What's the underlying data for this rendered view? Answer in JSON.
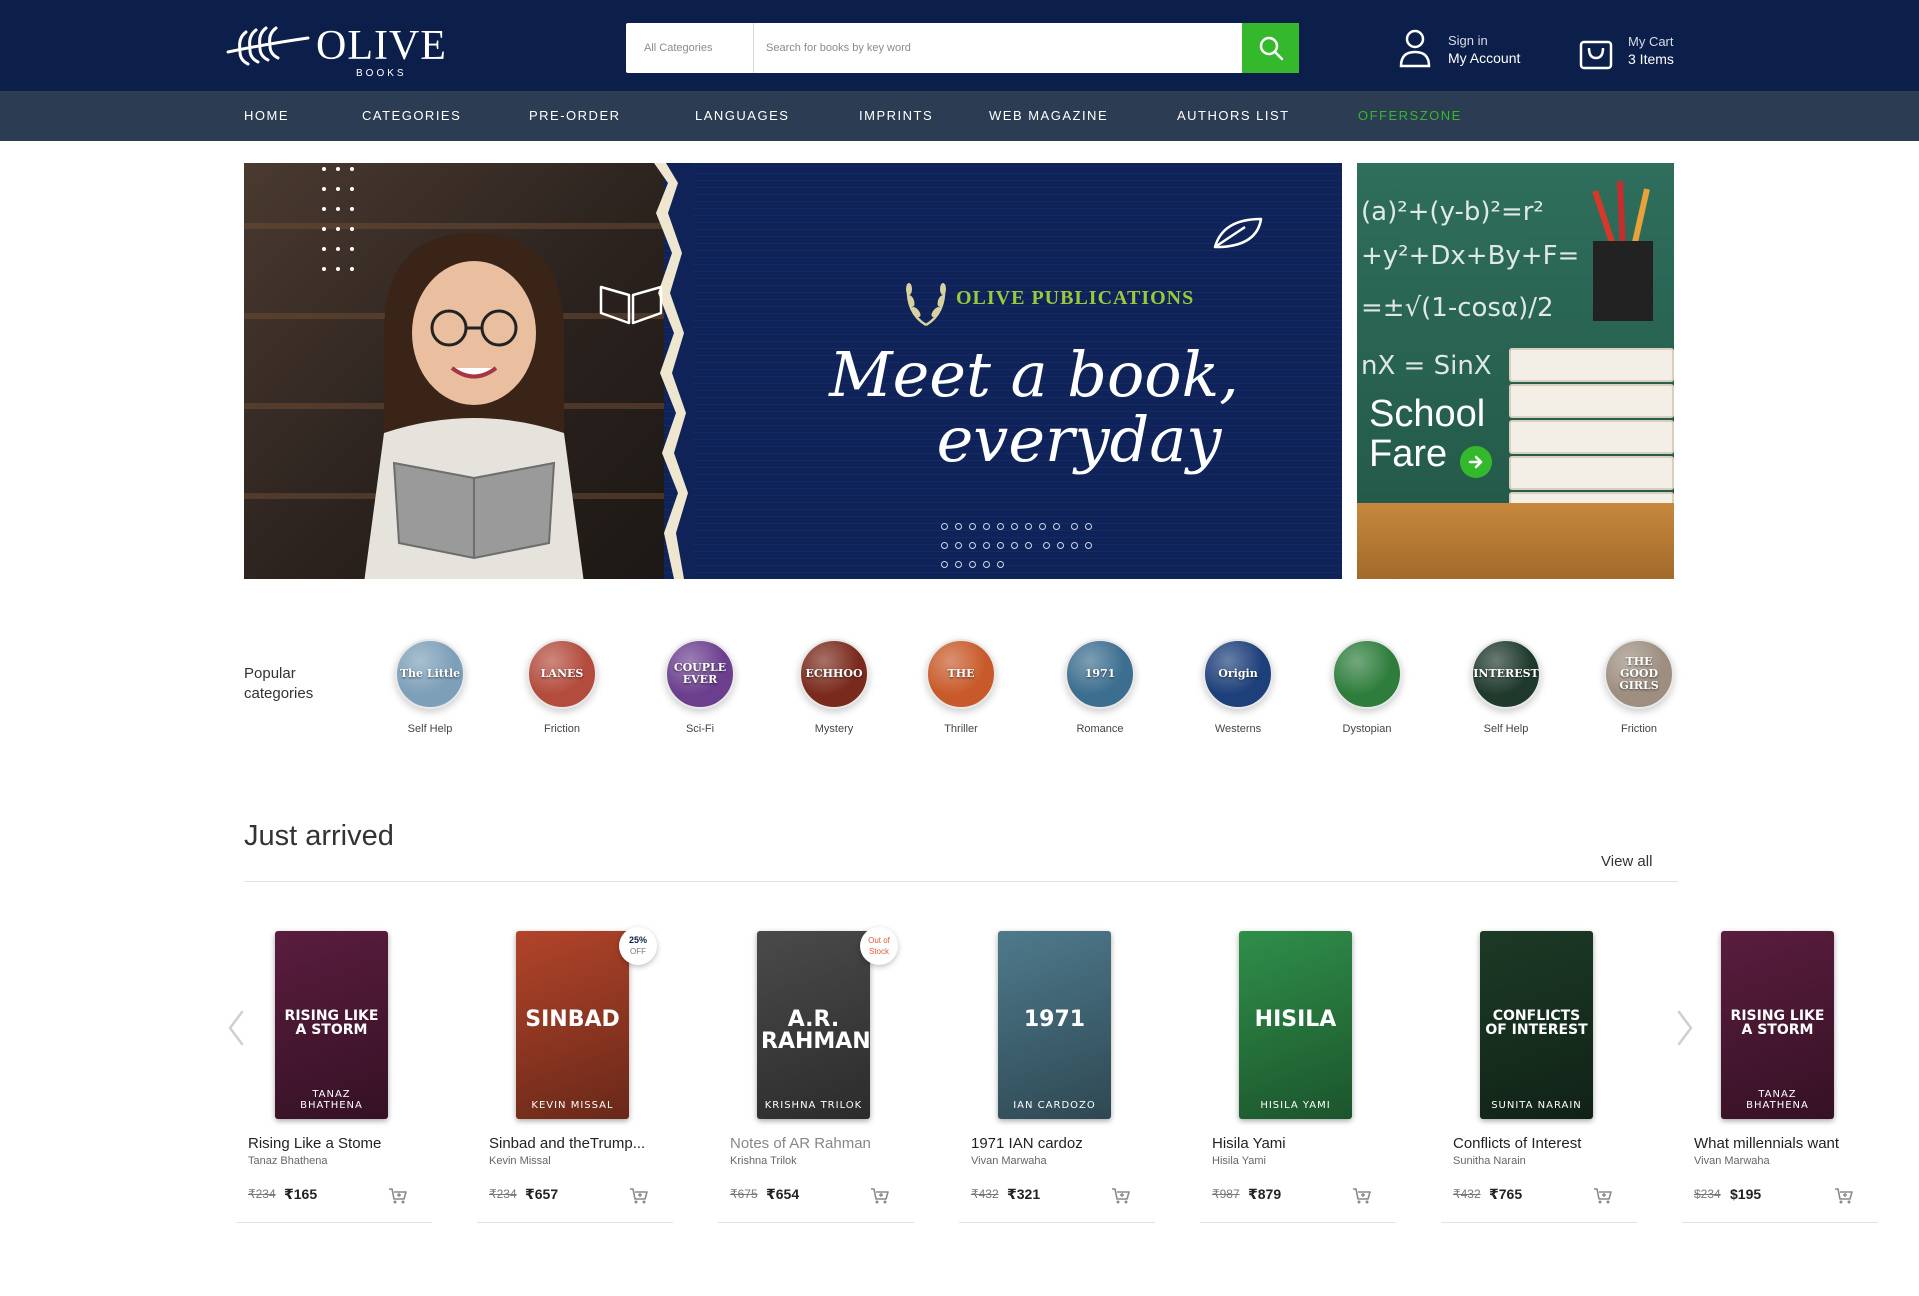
{
  "header": {
    "logo_text": "OLIVE",
    "logo_sub": "BOOKS",
    "search": {
      "category": "All Categories",
      "placeholder": "Search for books by key word"
    },
    "account": {
      "line1": "Sign in",
      "line2": "My Account"
    },
    "cart": {
      "line1": "My Cart",
      "line2": "3 Items"
    },
    "accent": "#35b92c",
    "bg": "#0c1f4a"
  },
  "nav": {
    "items": [
      "HOME",
      "CATEGORIES",
      "PRE-ORDER",
      "LANGUAGES",
      "IMPRINTS",
      "WEB MAGAZINE",
      "AUTHORS LIST",
      "OFFERSZONE"
    ],
    "bg": "#2c3c52"
  },
  "hero": {
    "publisher": "OLIVE PUBLICATIONS",
    "tagline1": "Meet a book,",
    "tagline2": "everyday"
  },
  "side_banner": {
    "line1": "School",
    "line2": "Fare"
  },
  "popular": {
    "label": "Popular categories",
    "items": [
      {
        "label": "Self Help",
        "cover_text": "The Little",
        "color": "#7d9fb8"
      },
      {
        "label": "Friction",
        "cover_text": "LANES",
        "color": "#b34c3c"
      },
      {
        "label": "Sci-Fi",
        "cover_text": "COUPLE EVER",
        "color": "#6b3f8e"
      },
      {
        "label": "Mystery",
        "cover_text": "ECHHOO",
        "color": "#7a2a1c"
      },
      {
        "label": "Thriller",
        "cover_text": "THE",
        "color": "#c85a2a"
      },
      {
        "label": "Romance",
        "cover_text": "1971",
        "color": "#3c6e8f"
      },
      {
        "label": "Westerns",
        "cover_text": "Origin",
        "color": "#1d3f7a"
      },
      {
        "label": "Dystopian",
        "cover_text": "",
        "color": "#2e7d3c"
      },
      {
        "label": "Self Help",
        "cover_text": "INTEREST",
        "color": "#1f3a2c"
      },
      {
        "label": "Friction",
        "cover_text": "THE GOOD GIRLS",
        "color": "#9e8e80"
      }
    ]
  },
  "just_arrived": {
    "title": "Just arrived",
    "view_all": "View all",
    "books": [
      {
        "title": "Rising Like a Stome",
        "author": "Tanaz Bhathena",
        "old_price": "₹234",
        "price": "₹165",
        "cover_title": "RISING LIKE A STORM",
        "cover_author": "TANAZ BHATHENA",
        "cover_color": "#5a1d3e",
        "badge": null
      },
      {
        "title": "Sinbad and theTrump...",
        "author": "Kevin Missal",
        "old_price": "₹234",
        "price": "₹657",
        "cover_title": "SINBAD",
        "cover_author": "KEVIN MISSAL",
        "cover_color": "#b2442a",
        "badge": {
          "line1": "25%",
          "line2": "OFF",
          "type": "discount"
        }
      },
      {
        "title": "Notes of AR Rahman",
        "author": "Krishna Trilok",
        "old_price": "₹675",
        "price": "₹654",
        "cover_title": "A.R. RAHMAN",
        "cover_author": "KRISHNA TRILOK",
        "cover_color": "#4a4a4a",
        "badge": {
          "line1": "Out of",
          "line2": "Stock",
          "type": "oos"
        }
      },
      {
        "title": "1971 IAN cardoz",
        "author": "Vivan Marwaha",
        "old_price": "₹432",
        "price": "₹321",
        "cover_title": "1971",
        "cover_author": "IAN CARDOZO",
        "cover_color": "#4e7a8c",
        "badge": null
      },
      {
        "title": "Hisila Yami",
        "author": "Hisila Yami",
        "old_price": "₹987",
        "price": "₹879",
        "cover_title": "HISILA",
        "cover_author": "HISILA YAMI",
        "cover_color": "#2f8f4a",
        "badge": null
      },
      {
        "title": "Conflicts of Interest",
        "author": "Sunitha Narain",
        "old_price": "₹432",
        "price": "₹765",
        "cover_title": "CONFLICTS OF INTEREST",
        "cover_author": "SUNITA NARAIN",
        "cover_color": "#1c3a26",
        "badge": null
      },
      {
        "title": "What millennials want",
        "author": "Vivan Marwaha",
        "old_price": "$234",
        "price": "$195",
        "cover_title": "RISING LIKE A STORM",
        "cover_author": "TANAZ BHATHENA",
        "cover_color": "#5a1d3e",
        "badge": null
      }
    ]
  }
}
